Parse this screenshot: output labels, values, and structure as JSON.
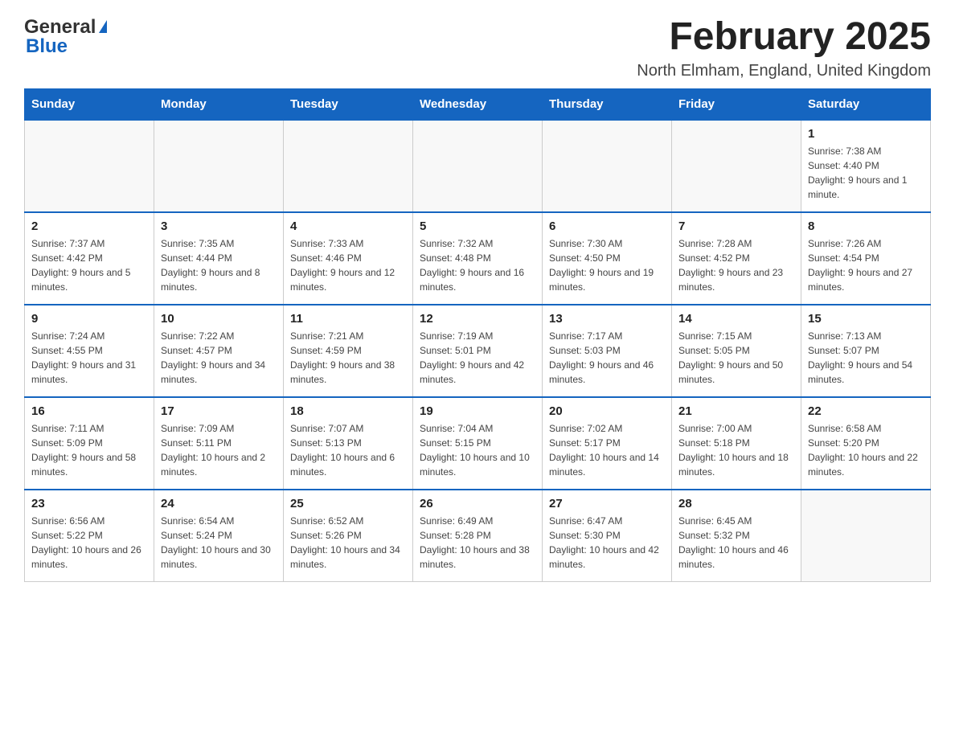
{
  "header": {
    "logo_general": "General",
    "logo_blue": "Blue",
    "month_title": "February 2025",
    "location": "North Elmham, England, United Kingdom"
  },
  "weekdays": [
    "Sunday",
    "Monday",
    "Tuesday",
    "Wednesday",
    "Thursday",
    "Friday",
    "Saturday"
  ],
  "weeks": [
    [
      {
        "day": "",
        "sunrise": "",
        "sunset": "",
        "daylight": ""
      },
      {
        "day": "",
        "sunrise": "",
        "sunset": "",
        "daylight": ""
      },
      {
        "day": "",
        "sunrise": "",
        "sunset": "",
        "daylight": ""
      },
      {
        "day": "",
        "sunrise": "",
        "sunset": "",
        "daylight": ""
      },
      {
        "day": "",
        "sunrise": "",
        "sunset": "",
        "daylight": ""
      },
      {
        "day": "",
        "sunrise": "",
        "sunset": "",
        "daylight": ""
      },
      {
        "day": "1",
        "sunrise": "Sunrise: 7:38 AM",
        "sunset": "Sunset: 4:40 PM",
        "daylight": "Daylight: 9 hours and 1 minute."
      }
    ],
    [
      {
        "day": "2",
        "sunrise": "Sunrise: 7:37 AM",
        "sunset": "Sunset: 4:42 PM",
        "daylight": "Daylight: 9 hours and 5 minutes."
      },
      {
        "day": "3",
        "sunrise": "Sunrise: 7:35 AM",
        "sunset": "Sunset: 4:44 PM",
        "daylight": "Daylight: 9 hours and 8 minutes."
      },
      {
        "day": "4",
        "sunrise": "Sunrise: 7:33 AM",
        "sunset": "Sunset: 4:46 PM",
        "daylight": "Daylight: 9 hours and 12 minutes."
      },
      {
        "day": "5",
        "sunrise": "Sunrise: 7:32 AM",
        "sunset": "Sunset: 4:48 PM",
        "daylight": "Daylight: 9 hours and 16 minutes."
      },
      {
        "day": "6",
        "sunrise": "Sunrise: 7:30 AM",
        "sunset": "Sunset: 4:50 PM",
        "daylight": "Daylight: 9 hours and 19 minutes."
      },
      {
        "day": "7",
        "sunrise": "Sunrise: 7:28 AM",
        "sunset": "Sunset: 4:52 PM",
        "daylight": "Daylight: 9 hours and 23 minutes."
      },
      {
        "day": "8",
        "sunrise": "Sunrise: 7:26 AM",
        "sunset": "Sunset: 4:54 PM",
        "daylight": "Daylight: 9 hours and 27 minutes."
      }
    ],
    [
      {
        "day": "9",
        "sunrise": "Sunrise: 7:24 AM",
        "sunset": "Sunset: 4:55 PM",
        "daylight": "Daylight: 9 hours and 31 minutes."
      },
      {
        "day": "10",
        "sunrise": "Sunrise: 7:22 AM",
        "sunset": "Sunset: 4:57 PM",
        "daylight": "Daylight: 9 hours and 34 minutes."
      },
      {
        "day": "11",
        "sunrise": "Sunrise: 7:21 AM",
        "sunset": "Sunset: 4:59 PM",
        "daylight": "Daylight: 9 hours and 38 minutes."
      },
      {
        "day": "12",
        "sunrise": "Sunrise: 7:19 AM",
        "sunset": "Sunset: 5:01 PM",
        "daylight": "Daylight: 9 hours and 42 minutes."
      },
      {
        "day": "13",
        "sunrise": "Sunrise: 7:17 AM",
        "sunset": "Sunset: 5:03 PM",
        "daylight": "Daylight: 9 hours and 46 minutes."
      },
      {
        "day": "14",
        "sunrise": "Sunrise: 7:15 AM",
        "sunset": "Sunset: 5:05 PM",
        "daylight": "Daylight: 9 hours and 50 minutes."
      },
      {
        "day": "15",
        "sunrise": "Sunrise: 7:13 AM",
        "sunset": "Sunset: 5:07 PM",
        "daylight": "Daylight: 9 hours and 54 minutes."
      }
    ],
    [
      {
        "day": "16",
        "sunrise": "Sunrise: 7:11 AM",
        "sunset": "Sunset: 5:09 PM",
        "daylight": "Daylight: 9 hours and 58 minutes."
      },
      {
        "day": "17",
        "sunrise": "Sunrise: 7:09 AM",
        "sunset": "Sunset: 5:11 PM",
        "daylight": "Daylight: 10 hours and 2 minutes."
      },
      {
        "day": "18",
        "sunrise": "Sunrise: 7:07 AM",
        "sunset": "Sunset: 5:13 PM",
        "daylight": "Daylight: 10 hours and 6 minutes."
      },
      {
        "day": "19",
        "sunrise": "Sunrise: 7:04 AM",
        "sunset": "Sunset: 5:15 PM",
        "daylight": "Daylight: 10 hours and 10 minutes."
      },
      {
        "day": "20",
        "sunrise": "Sunrise: 7:02 AM",
        "sunset": "Sunset: 5:17 PM",
        "daylight": "Daylight: 10 hours and 14 minutes."
      },
      {
        "day": "21",
        "sunrise": "Sunrise: 7:00 AM",
        "sunset": "Sunset: 5:18 PM",
        "daylight": "Daylight: 10 hours and 18 minutes."
      },
      {
        "day": "22",
        "sunrise": "Sunrise: 6:58 AM",
        "sunset": "Sunset: 5:20 PM",
        "daylight": "Daylight: 10 hours and 22 minutes."
      }
    ],
    [
      {
        "day": "23",
        "sunrise": "Sunrise: 6:56 AM",
        "sunset": "Sunset: 5:22 PM",
        "daylight": "Daylight: 10 hours and 26 minutes."
      },
      {
        "day": "24",
        "sunrise": "Sunrise: 6:54 AM",
        "sunset": "Sunset: 5:24 PM",
        "daylight": "Daylight: 10 hours and 30 minutes."
      },
      {
        "day": "25",
        "sunrise": "Sunrise: 6:52 AM",
        "sunset": "Sunset: 5:26 PM",
        "daylight": "Daylight: 10 hours and 34 minutes."
      },
      {
        "day": "26",
        "sunrise": "Sunrise: 6:49 AM",
        "sunset": "Sunset: 5:28 PM",
        "daylight": "Daylight: 10 hours and 38 minutes."
      },
      {
        "day": "27",
        "sunrise": "Sunrise: 6:47 AM",
        "sunset": "Sunset: 5:30 PM",
        "daylight": "Daylight: 10 hours and 42 minutes."
      },
      {
        "day": "28",
        "sunrise": "Sunrise: 6:45 AM",
        "sunset": "Sunset: 5:32 PM",
        "daylight": "Daylight: 10 hours and 46 minutes."
      },
      {
        "day": "",
        "sunrise": "",
        "sunset": "",
        "daylight": ""
      }
    ]
  ]
}
